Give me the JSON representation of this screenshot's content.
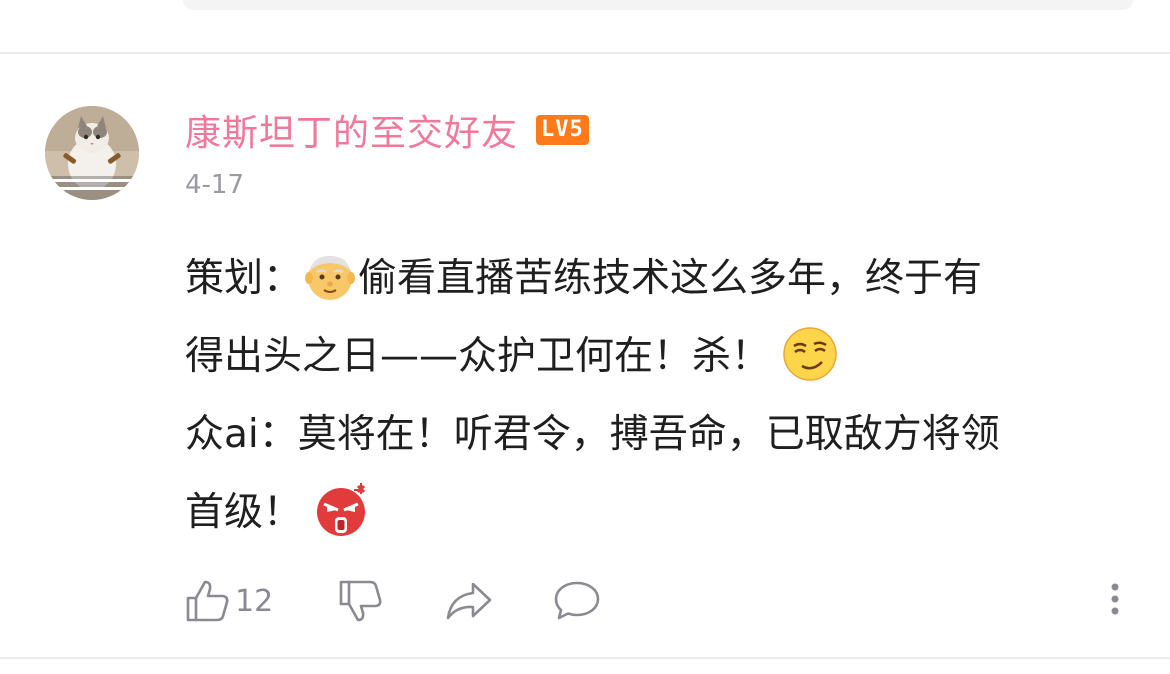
{
  "comment": {
    "username": "康斯坦丁的至交好友",
    "level_badge": "LV5",
    "date": "4-17",
    "avatar_icon": "cat-avatar",
    "lines": [
      {
        "before": "策划：",
        "emoji": "old-man-emoji",
        "after": "偷看直播苦练技术这么多年，终于有"
      },
      {
        "before": "得出头之日——众护卫何在！杀！",
        "emoji": "smirk-emoji",
        "after": ""
      },
      {
        "before": "众ai：莫将在！听君令，搏吾命，已取敌方将领",
        "emoji": "",
        "after": ""
      },
      {
        "before": "首级！",
        "emoji": "angry-emoji",
        "after": ""
      }
    ],
    "actions": {
      "like_icon": "thumbs-up-icon",
      "like_count": "12",
      "dislike_icon": "thumbs-down-icon",
      "share_icon": "share-icon",
      "reply_icon": "comment-icon",
      "more_icon": "more-vertical-icon"
    }
  },
  "colors": {
    "username": "#f0789a",
    "badge": "#ff7a1a",
    "date": "#9a9aa2",
    "text": "#1f1f1f",
    "icon": "#8a8a92"
  }
}
